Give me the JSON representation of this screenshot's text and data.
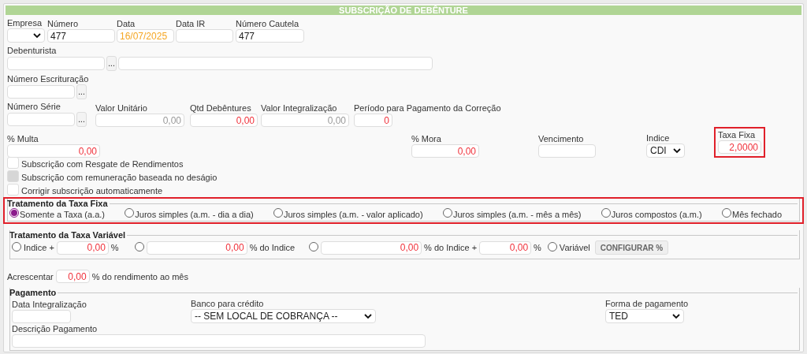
{
  "title": "SUBSCRIÇÃO DE DEBÊNTURE",
  "rows": [
    [
      {
        "label": "Empresa",
        "kind": "select"
      },
      {
        "label": "Número",
        "kind": "text",
        "value": "477"
      },
      {
        "label": "Data",
        "kind": "date",
        "value": "16/07/2025"
      },
      {
        "label": "Data IR",
        "kind": "text"
      },
      {
        "label": "Número Cautela",
        "kind": "text",
        "value": "477"
      }
    ],
    [
      {
        "label": "Debenturista",
        "kind": "lookup",
        "button": "...",
        "description_field": true
      }
    ],
    [
      {
        "label": "Número Escrituração",
        "kind": "lookup",
        "button": "...",
        "description_field": false
      }
    ],
    [
      {
        "label": "Número Série",
        "kind": "lookup",
        "button": "...",
        "description_field": false
      },
      {
        "label": "Valor Unitário",
        "kind": "number",
        "value": "0,00",
        "disabled": true
      },
      {
        "label": "Qtd Debêntures",
        "kind": "number",
        "value": "0,00",
        "disabled": false
      },
      {
        "label": "Valor Integralização",
        "kind": "number",
        "value": "0,00",
        "disabled": true
      },
      {
        "label": "Período para Pagamento da Correção",
        "kind": "number",
        "value": "0",
        "disabled": false
      }
    ],
    [
      {
        "label": "% Multa",
        "kind": "number",
        "value": "0,00",
        "disabled": false
      },
      {
        "label": "% Mora",
        "kind": "number",
        "value": "0,00",
        "disabled": false
      },
      {
        "label": "Vencimento",
        "kind": "text"
      },
      {
        "label": "Indice",
        "kind": "select",
        "value": "CDI"
      },
      {
        "label": "Taxa Fixa",
        "kind": "number",
        "value": "2,0000",
        "disabled": false,
        "highlighted": true
      }
    ]
  ],
  "checkboxes": [
    {
      "label": "Subscrição com Resgate de Rendimentos",
      "checked": false,
      "disabled": false
    },
    {
      "label": "Subscrição com remuneração baseada no deságio",
      "checked": false,
      "disabled": true
    },
    {
      "label": "Corrigir subscrição automaticamente",
      "checked": false,
      "disabled": false
    }
  ],
  "fixed_rate": {
    "legend": "Tratamento da Taxa Fixa",
    "highlighted": true,
    "options": [
      {
        "label": "Somente a Taxa (a.a.)",
        "selected": true
      },
      {
        "label": "Juros simples (a.m. - dia a dia)",
        "selected": false
      },
      {
        "label": "Juros simples (a.m. - valor aplicado)",
        "selected": false
      },
      {
        "label": "Juros simples (a.m. - mês a mês)",
        "selected": false
      },
      {
        "label": "Juros compostos (a.m.)",
        "selected": false
      },
      {
        "label": "Mês fechado",
        "selected": false
      }
    ]
  },
  "variable_rate": {
    "legend": "Tratamento da Taxa Variável",
    "options": [
      {
        "selected": false,
        "parts": [
          {
            "kind": "text",
            "text": "Indice +"
          },
          {
            "kind": "input",
            "value": "0,00"
          },
          {
            "kind": "text",
            "text": "%"
          }
        ]
      },
      {
        "selected": false,
        "parts": [
          {
            "kind": "input",
            "value": "0,00"
          },
          {
            "kind": "text",
            "text": "% do Indice"
          }
        ]
      },
      {
        "selected": false,
        "parts": [
          {
            "kind": "input",
            "value": "0,00"
          },
          {
            "kind": "text",
            "text": "% do Indice +"
          },
          {
            "kind": "input",
            "value": "0,00"
          },
          {
            "kind": "text",
            "text": "%"
          }
        ]
      },
      {
        "selected": false,
        "parts": [
          {
            "kind": "text",
            "text": "Variável"
          }
        ]
      }
    ],
    "button": "CONFIGURAR %"
  },
  "accrual": {
    "label": "Acrescentar",
    "value": "0,00",
    "suffix": "% do rendimento ao mês"
  },
  "payment": {
    "legend": "Pagamento",
    "fields": [
      {
        "label": "Data Integralização",
        "kind": "text"
      },
      {
        "label": "Banco para crédito",
        "kind": "select",
        "value": "-- SEM LOCAL DE COBRANÇA --"
      },
      {
        "label": "Forma de pagamento",
        "kind": "select",
        "value": "TED"
      },
      {
        "label": "Descrição Pagamento",
        "kind": "text"
      }
    ]
  }
}
